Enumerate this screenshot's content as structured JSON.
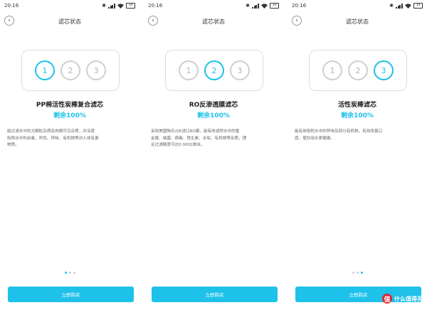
{
  "status": {
    "time": "20:16",
    "battery": "34"
  },
  "icons": [
    "bluetooth-icon",
    "signal-icon",
    "wifi-icon",
    "battery-icon",
    "chevron-left-icon"
  ],
  "colors": {
    "accent": "#1ec1ea",
    "inactive": "#cfcfcf"
  },
  "screens": [
    {
      "nav_title": "滤芯状态",
      "steps": [
        "1",
        "2",
        "3"
      ],
      "active_step": 1,
      "filter_name": "PP棉活性炭棒复合滤芯",
      "remaining": "剩余100%",
      "description": "能过滤水中的大颗粒杂质及肉眼可见杂质，并深度\n吸附水中的余氯、异色、异味、有机物等对人体有害\n物质。",
      "active_dot": 1,
      "buy_label": "立即购买"
    },
    {
      "nav_title": "滤芯状态",
      "steps": [
        "1",
        "2",
        "3"
      ],
      "active_step": 2,
      "filter_name": "RO反渗透膜滤芯",
      "remaining": "剩余100%",
      "description": "采用美国陶氏/GE进口RO膜，能有效滤除水中的重\n金属、细菌、病毒、残生素、水垢、有机物等杂质，理\n论过滤精度可达0.0001微米。",
      "active_dot": 2,
      "buy_label": "立即购买"
    },
    {
      "nav_title": "滤芯状态",
      "steps": [
        "1",
        "2",
        "3"
      ],
      "active_step": 3,
      "filter_name": "活性炭棒滤芯",
      "remaining": "剩余100%",
      "description": "能有效吸附水中的异味及部分有机物，有效改善口\n感，使饮用水更健康。",
      "active_dot": 3,
      "buy_label": "立即购买"
    }
  ],
  "watermark": {
    "text": "值 什么值得买"
  }
}
